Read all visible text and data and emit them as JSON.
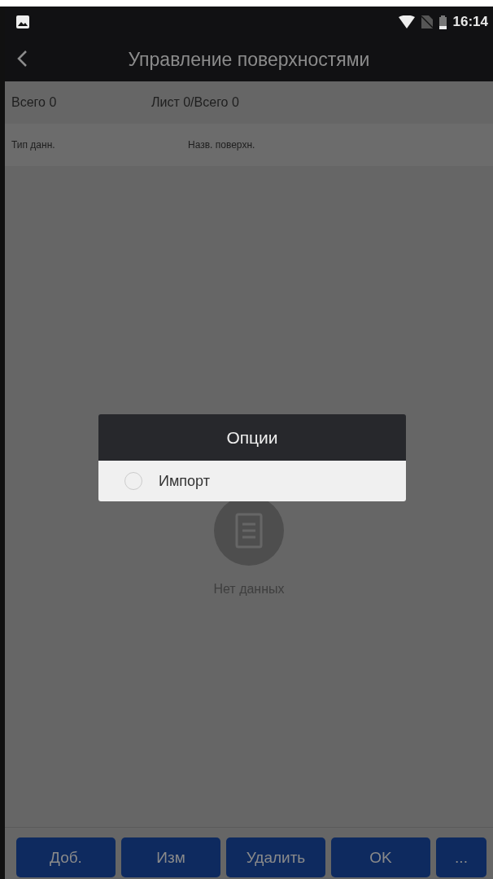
{
  "status_bar": {
    "time": "16:14"
  },
  "app_bar": {
    "title": "Управление поверхностями"
  },
  "summary": {
    "total": "Всего 0",
    "page": "Лист 0/Всего 0"
  },
  "table": {
    "columns": [
      "Тип данн.",
      "Назв. поверхн."
    ]
  },
  "empty_state": {
    "text": "Нет данных"
  },
  "dialog": {
    "title": "Опции",
    "options": [
      {
        "label": "Импорт",
        "selected": false
      }
    ]
  },
  "buttons": [
    "Доб.",
    "Изм",
    "Удалить",
    "OK",
    "..."
  ]
}
